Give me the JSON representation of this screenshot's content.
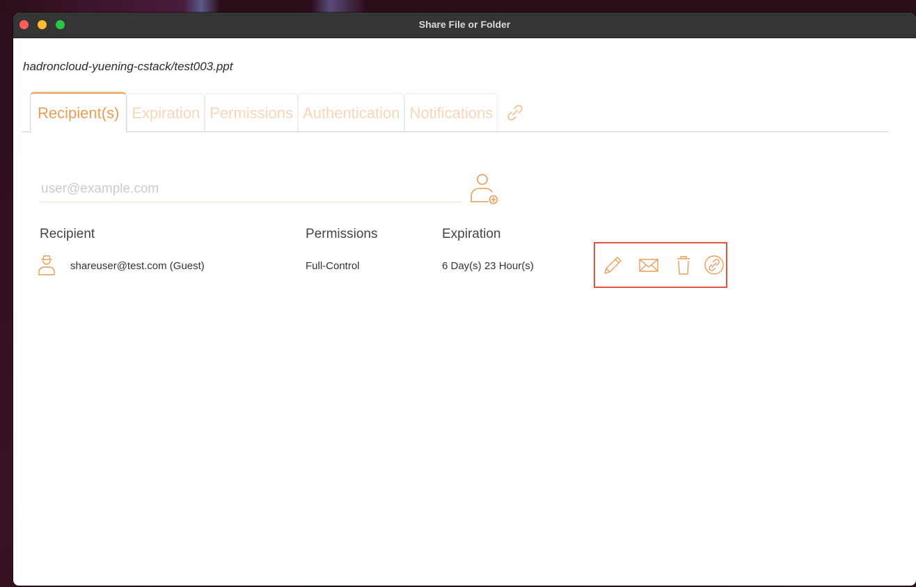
{
  "window": {
    "title": "Share File or Folder"
  },
  "file_path": "hadroncloud-yuening-cstack/test003.ppt",
  "tabs": [
    {
      "label": "Recipient(s)",
      "active": true
    },
    {
      "label": "Expiration",
      "active": false
    },
    {
      "label": "Permissions",
      "active": false
    },
    {
      "label": "Authentication",
      "active": false
    },
    {
      "label": "Notifications",
      "active": false
    }
  ],
  "recipient_input": {
    "placeholder": "user@example.com",
    "value": ""
  },
  "table": {
    "headers": {
      "recipient": "Recipient",
      "permissions": "Permissions",
      "expiration": "Expiration"
    },
    "rows": [
      {
        "recipient": "shareuser@test.com (Guest)",
        "permissions": "Full-Control",
        "expiration": "6 Day(s) 23 Hour(s)"
      }
    ]
  },
  "icons": {
    "tab_link": "link-icon",
    "add_user": "add-user-icon",
    "guest": "guest-user-icon",
    "edit": "pencil-icon",
    "email": "envelope-icon",
    "delete": "trash-icon",
    "link": "link-circle-icon"
  },
  "colors": {
    "accent": "#ec9c55",
    "accent_light": "#f6d6b8",
    "highlight_box": "#e0543a",
    "titlebar": "#353535"
  }
}
